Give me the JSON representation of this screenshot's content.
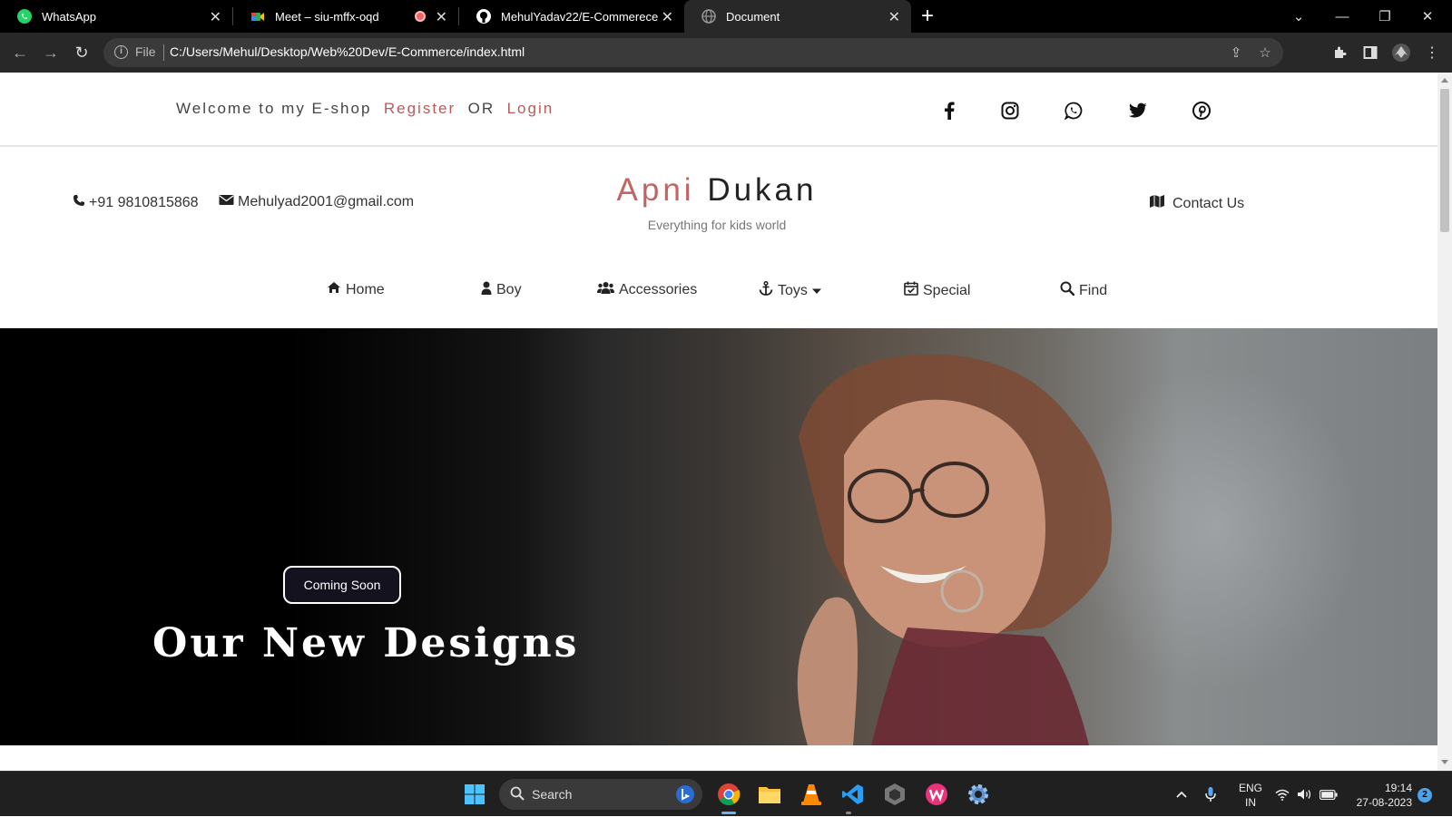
{
  "browser": {
    "tabs": [
      {
        "title": "WhatsApp",
        "icon": "whatsapp-icon"
      },
      {
        "title": "Meet – siu-mffx-oqd",
        "icon": "google-meet-icon",
        "recording": true
      },
      {
        "title": "MehulYadav22/E-Commerece",
        "icon": "github-icon"
      },
      {
        "title": "Document",
        "icon": "globe-icon",
        "active": true
      }
    ],
    "address": {
      "scheme_label": "File",
      "url": "C:/Users/Mehul/Desktop/Web%20Dev/E-Commerce/index.html"
    }
  },
  "page": {
    "topbar": {
      "welcome": "Welcome to my E-shop",
      "register": "Register",
      "or": "OR",
      "login": "Login",
      "socials": [
        "facebook-icon",
        "instagram-icon",
        "whatsapp-icon",
        "twitter-icon",
        "pinterest-icon"
      ]
    },
    "header": {
      "phone": "+91 9810815868",
      "email": "Mehulyad2001@gmail.com",
      "brand_first": "Apni",
      "brand_second": "Dukan",
      "tagline": "Everything for kids world",
      "contact": "Contact Us"
    },
    "nav": {
      "items": [
        {
          "label": "Home",
          "icon": "home-icon"
        },
        {
          "label": "Boy",
          "icon": "user-icon"
        },
        {
          "label": "Accessories",
          "icon": "users-icon"
        },
        {
          "label": "Toys",
          "icon": "anchor-icon",
          "dropdown": true
        },
        {
          "label": "Special",
          "icon": "calendar-check-icon"
        },
        {
          "label": "Find",
          "icon": "search-icon"
        }
      ]
    },
    "hero": {
      "badge": "Coming Soon",
      "title": "Our New Designs"
    }
  },
  "taskbar": {
    "search_placeholder": "Search",
    "language": {
      "line1": "ENG",
      "line2": "IN"
    },
    "time": "19:14",
    "date": "27-08-2023",
    "notifications": "2"
  },
  "colors": {
    "brand_accent": "#c06464",
    "link_accent": "#b85a5a",
    "hero_badge_bg": "#14121f"
  }
}
